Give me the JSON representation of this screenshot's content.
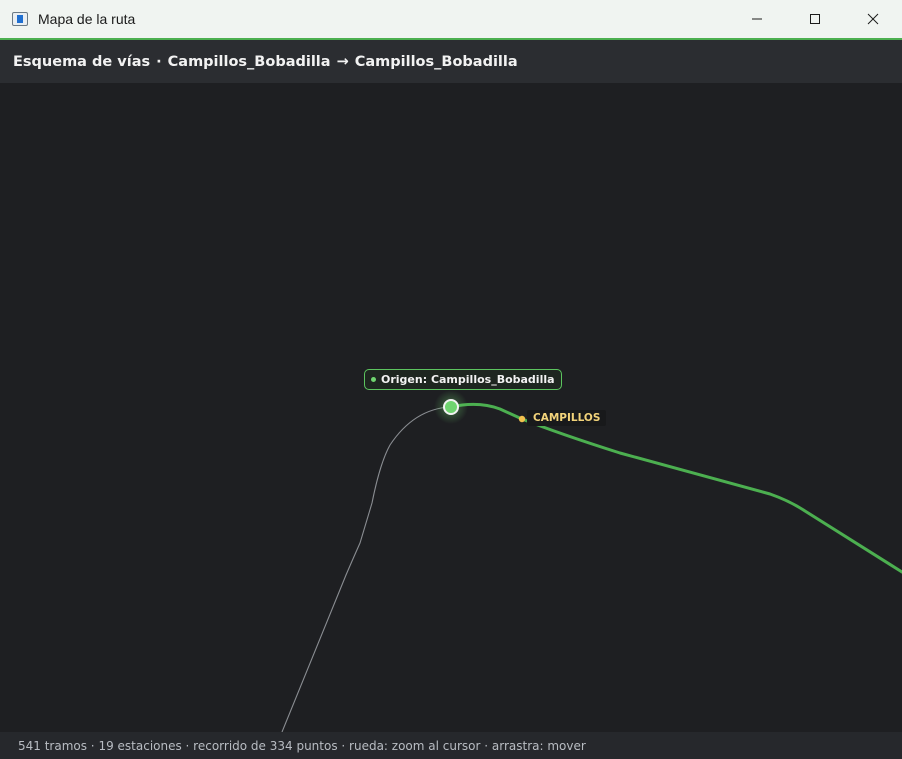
{
  "window": {
    "title": "Mapa de la ruta",
    "controls": {
      "minimize_icon": "minimize-icon",
      "maximize_icon": "maximize-icon",
      "close_icon": "close-icon"
    }
  },
  "header": {
    "prefix": "Esquema de vías",
    "separator": "·",
    "origin": "Campillos_Bobadilla",
    "arrow": "→",
    "destination": "Campillos_Bobadilla"
  },
  "map": {
    "origin_label": "Origen: Campillos_Bobadilla",
    "stations": [
      {
        "name": "CAMPILLOS"
      }
    ],
    "colors": {
      "route": "#4caf50",
      "track": "#8a8d92",
      "station": "#f2c14e",
      "origin": "#6fd46f",
      "background": "#1e1f22"
    }
  },
  "status": {
    "text": "541 tramos · 19 estaciones · recorrido de 334 puntos · rueda: zoom al cursor · arrastra: mover"
  }
}
